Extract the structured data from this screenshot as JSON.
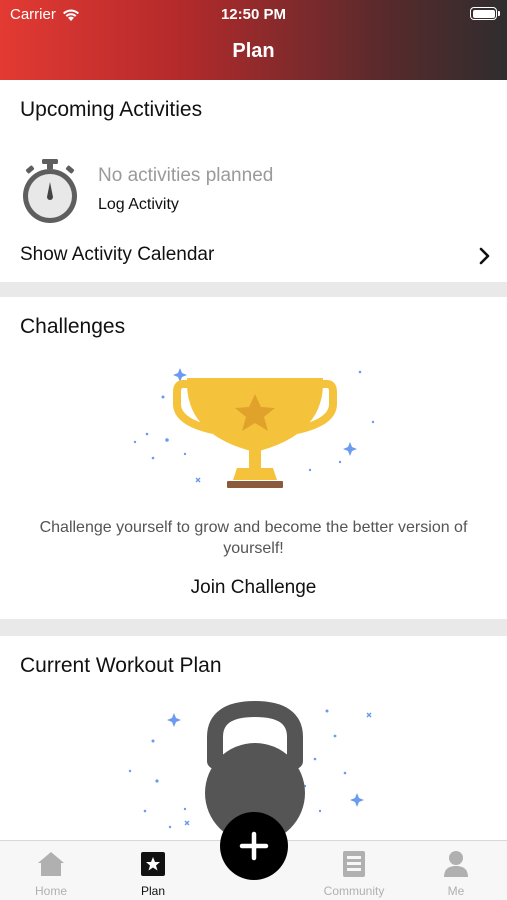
{
  "status_bar": {
    "carrier": "Carrier",
    "time": "12:50 PM"
  },
  "nav": {
    "title": "Plan"
  },
  "upcoming": {
    "title": "Upcoming Activities",
    "empty_text": "No activities planned",
    "log_label": "Log Activity",
    "calendar_label": "Show Activity Calendar"
  },
  "challenges": {
    "title": "Challenges",
    "description": "Challenge yourself to grow and become the better version of yourself!",
    "join_label": "Join Challenge"
  },
  "workout": {
    "title": "Current Workout Plan"
  },
  "tabbar": {
    "items": [
      {
        "label": "Home",
        "icon": "home-icon"
      },
      {
        "label": "Plan",
        "icon": "plan-icon"
      },
      {
        "label": "Community",
        "icon": "community-icon"
      },
      {
        "label": "Me",
        "icon": "profile-icon"
      }
    ],
    "active": "Plan",
    "fab_icon": "plus-icon"
  },
  "colors": {
    "header_start": "#e33a33",
    "header_end": "#2f2d2e",
    "trophy": "#f5c33b",
    "trophy_base": "#8a5a3a",
    "sparkle": "#6b9bf0",
    "kettlebell": "#555555"
  }
}
